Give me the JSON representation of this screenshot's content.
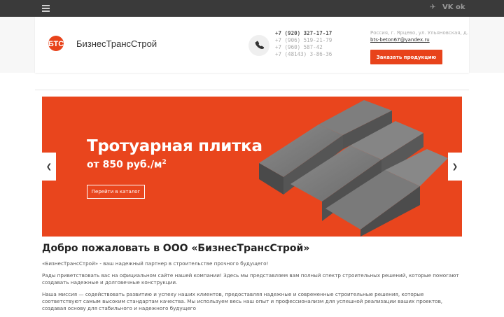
{
  "topbar": {
    "menu_icon": "hamburger-menu-icon",
    "social": [
      {
        "name": "telegram-icon",
        "glyph": "✈"
      },
      {
        "name": "vk-icon",
        "glyph": "VK"
      },
      {
        "name": "odnoklassniki-icon",
        "glyph": "ok"
      }
    ]
  },
  "header": {
    "logo_mark": "БТС",
    "logo_text": "БизнесТрансСтрой",
    "phone_icon": "phone-icon",
    "phones": [
      "+7 (920) 327-17-17",
      "+7 (906) 519-21-79",
      "+7 (960) 587-42",
      "+7 (48143) 3-86-36"
    ],
    "address": "Россия, г. Ярцево, ул. Ульяновская, д.",
    "email": "bts-beton67@yandex.ru",
    "order_button": "Заказать продукцию"
  },
  "slider": {
    "title": "Тротуарная плитка",
    "price": "от 850 руб./м",
    "price_sup": "2",
    "button": "Перейти в каталог",
    "prev_glyph": "❮",
    "next_glyph": "❯"
  },
  "content": {
    "heading": "Добро пожаловать в ООО «БизнесТрансСтрой»",
    "p1": "«БизнесТрансСтрой»  - ваш надежный партнер в строительстве прочного будущего!",
    "p2": "Рады приветствовать вас на официальном сайте нашей компании! Здесь мы представляем вам полный спектр строительных решений, которые помогают создавать надежные и долговечные конструкции.",
    "p3": "Наша миссия — содействовать развитию и успеху наших клиентов, предоставляя надежные и современные строительные решения, которые соответствуют самым высоким стандартам качества. Мы используем весь наш опыт и профессионализм для успешной реализации ваших проектов, создавая основу для стабильного и надежного будущего"
  },
  "colors": {
    "accent": "#e8431b",
    "topbar": "#3a3a3a"
  }
}
